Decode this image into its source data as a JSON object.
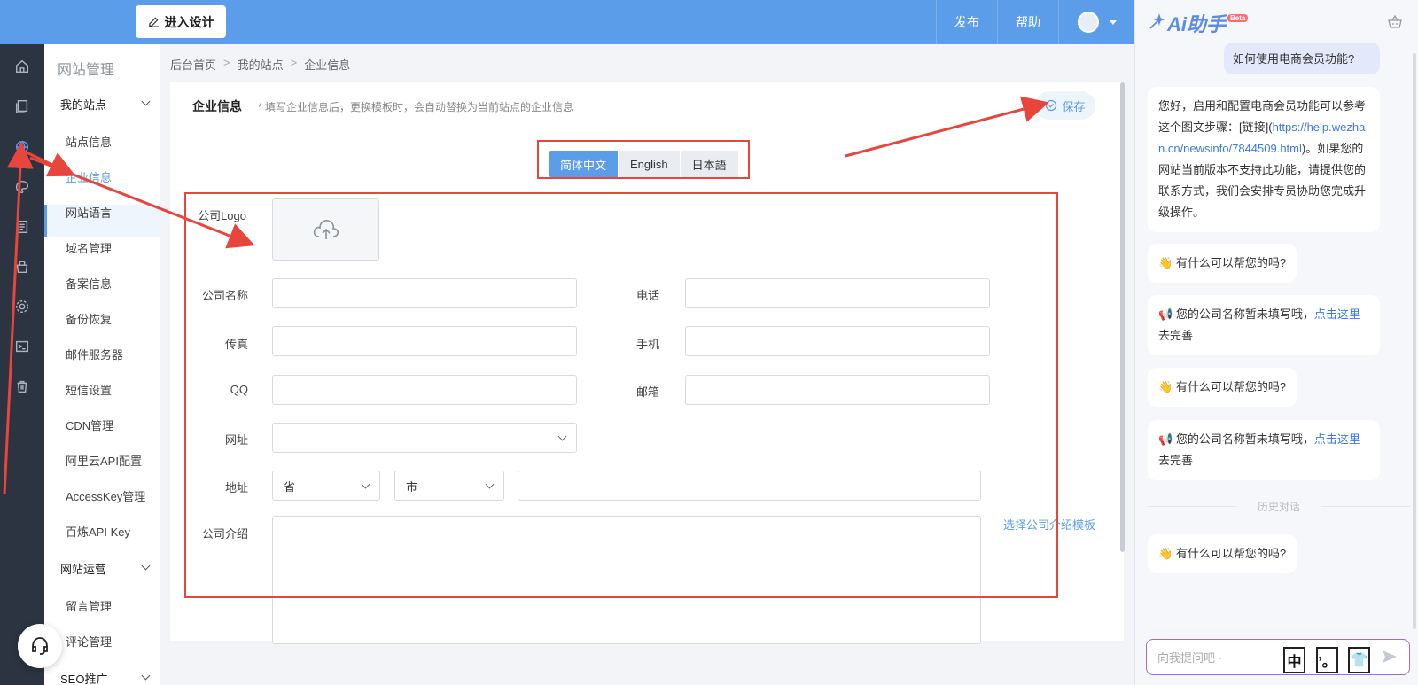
{
  "topbar": {
    "design_label": "进入设计",
    "nav": [
      "发布",
      "帮助"
    ]
  },
  "sidebar": {
    "title": "网站管理",
    "group_mysite": "我的站点",
    "items": [
      "站点信息",
      "企业信息",
      "网站语言",
      "域名管理",
      "备案信息",
      "备份恢复",
      "邮件服务器",
      "短信设置",
      "CDN管理",
      "阿里云API配置",
      "AccessKey管理",
      "百炼API Key"
    ],
    "group_operate": "网站运营",
    "operate_items": [
      "留言管理",
      "评论管理"
    ],
    "group_seo": "SEO推广"
  },
  "breadcrumb": [
    "后台首页",
    "我的站点",
    "企业信息"
  ],
  "panel": {
    "title": "企业信息",
    "note": "* 填写企业信息后，更换模板时，会自动替换为当前站点的企业信息",
    "save_label": "保存"
  },
  "lang_tabs": [
    "简体中文",
    "English",
    "日本語"
  ],
  "form": {
    "logo_label": "公司Logo",
    "company_name_label": "公司名称",
    "phone_label": "电话",
    "fax_label": "传真",
    "mobile_label": "手机",
    "qq_label": "QQ",
    "email_label": "邮箱",
    "website_label": "网址",
    "address_label": "地址",
    "province_placeholder": "省",
    "city_placeholder": "市",
    "intro_label": "公司介绍",
    "template_link": "选择公司介绍模板"
  },
  "ai": {
    "logo": "Ai助手",
    "beta": "Beta",
    "user_msg": "如何使用电商会员功能?",
    "answer_1": "您好，启用和配置电商会员功能可以参考这个图文步骤：[链接](",
    "answer_link": "https://help.wezhan.cn/newsinfo/7844509.html",
    "answer_2": ")。如果您的网站当前版本不支持此功能，请提供您的联系方式，我们会安排专员协助您完成升级操作。",
    "help_msg": "有什么可以帮您的吗?",
    "notice_msg": "您的公司名称暂未填写哦，",
    "notice_link": "点击这里",
    "notice_tail": "去完善",
    "history_divider": "历史对话",
    "input_placeholder": "向我提问吧~",
    "ime": [
      "中",
      "’。",
      "👕"
    ]
  },
  "colors": {
    "primary": "#5b9de8",
    "rail": "#2b3440",
    "annotation": "#e8453c"
  }
}
